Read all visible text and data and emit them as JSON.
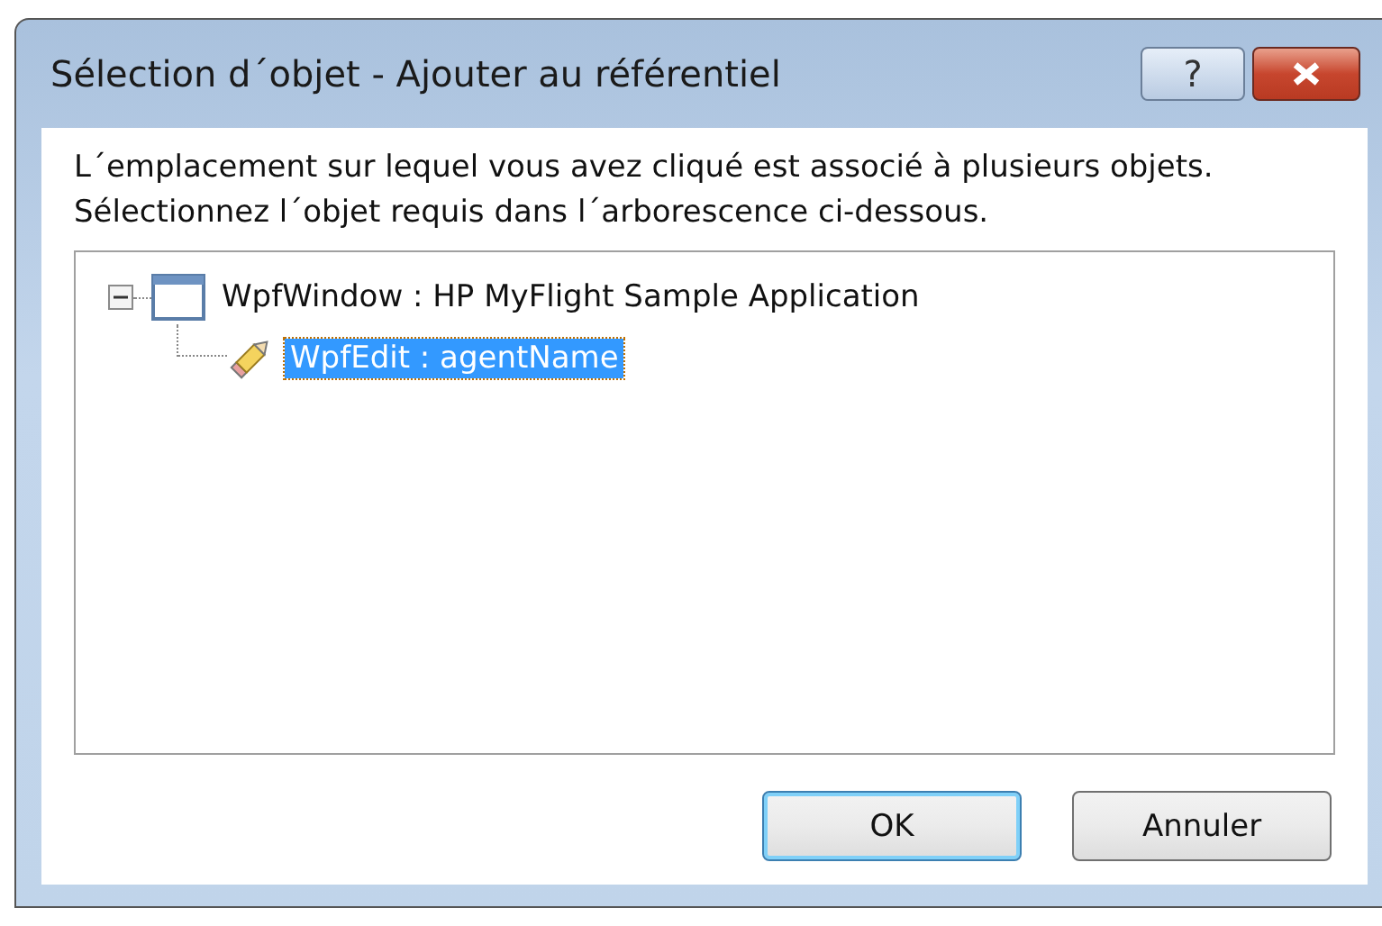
{
  "window": {
    "title": "Sélection d´objet - Ajouter au référentiel",
    "help_button": "?"
  },
  "message": [
    "L´emplacement sur lequel vous avez cliqué est associé à plusieurs objets.",
    "Sélectionnez l´objet requis dans l´arborescence ci-dessous."
  ],
  "tree": [
    {
      "label": "WpfWindow : HP MyFlight Sample Application",
      "kind": "window",
      "expanded": true,
      "selected": false,
      "children": [
        {
          "label": "WpfEdit : agentName",
          "kind": "edit",
          "selected": true
        }
      ]
    }
  ],
  "buttons": [
    {
      "label": "OK",
      "default": true
    },
    {
      "label": "Annuler",
      "default": false
    }
  ]
}
